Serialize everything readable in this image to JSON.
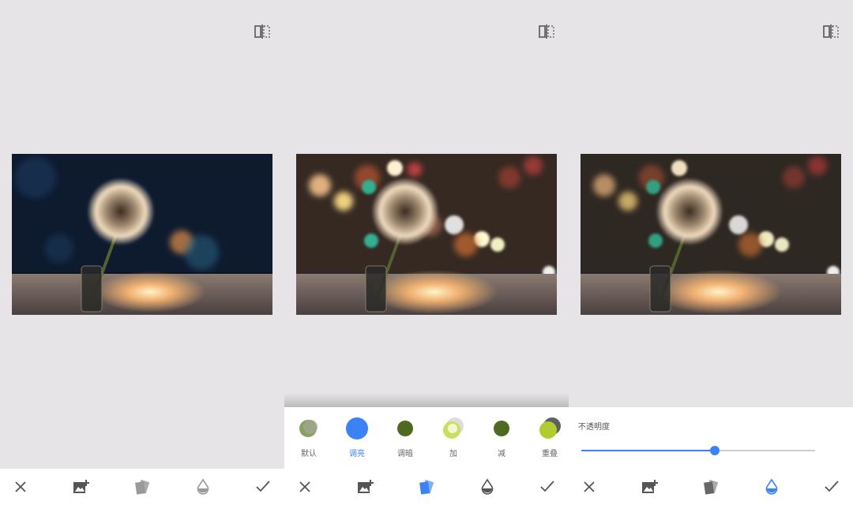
{
  "blend_modes": [
    {
      "label": "默认",
      "active": false
    },
    {
      "label": "调亮",
      "active": true
    },
    {
      "label": "调暗",
      "active": false
    },
    {
      "label": "加",
      "active": false
    },
    {
      "label": "减",
      "active": false
    },
    {
      "label": "重叠",
      "active": false
    }
  ],
  "opacity": {
    "label": "不透明度",
    "value": 0.57
  },
  "toolbar": {
    "icons": [
      "close-icon",
      "add-image-icon",
      "layers-icon",
      "opacity-drop-icon",
      "check-icon"
    ]
  },
  "colors": {
    "accent": "#3b82f6",
    "background": "#e6e4e6",
    "sheet": "#ffffff",
    "icon": "#555555"
  }
}
